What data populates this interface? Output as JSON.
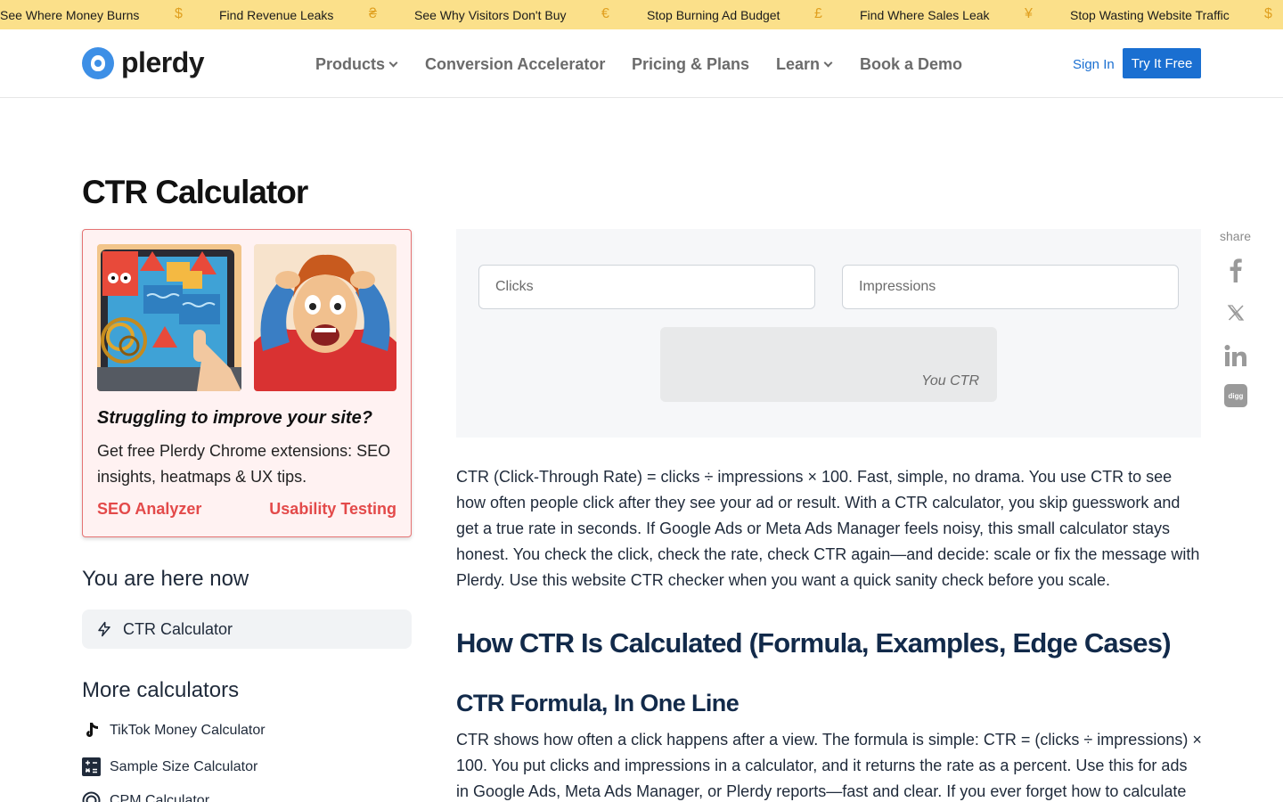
{
  "ticker": {
    "items": [
      "See Where Money Burns",
      "Find Revenue Leaks",
      "See Why Visitors Don't Buy",
      "Stop Burning Ad Budget",
      "Find Where Sales Leak",
      "Stop Wasting Website Traffic"
    ],
    "symbols": [
      "$",
      "₴",
      "€",
      "£",
      "¥",
      "$"
    ]
  },
  "header": {
    "logo_text": "plerdy",
    "nav": [
      "Products",
      "Conversion Accelerator",
      "Pricing & Plans",
      "Learn",
      "Book a Demo"
    ],
    "sign_in": "Sign In",
    "try_free": "Try It Free"
  },
  "page_title": "CTR Calculator",
  "promo": {
    "heading": "Struggling to improve your site?",
    "text": "Get free Plerdy Chrome extensions: SEO insights, heatmaps & UX tips.",
    "link1": "SEO Analyzer",
    "link2": "Usability Testing"
  },
  "sidebar": {
    "here_heading": "You are here now",
    "current": "CTR Calculator",
    "more_heading": "More calculators",
    "calculators": [
      "TikTok Money Calculator",
      "Sample Size Calculator",
      "CPM Calculator"
    ]
  },
  "calculator": {
    "clicks_placeholder": "Clicks",
    "impressions_placeholder": "Impressions",
    "result_label": "You CTR"
  },
  "share": {
    "label": "share",
    "icons": [
      "facebook-icon",
      "x-icon",
      "linkedin-icon",
      "digg-icon"
    ]
  },
  "article": {
    "intro": "CTR (Click-Through Rate) = clicks ÷ impressions × 100. Fast, simple, no drama. You use CTR to see how often people click after they see your ad or result. With a CTR calculator, you skip guesswork and get a true rate in seconds. If Google Ads or Meta Ads Manager feels noisy, this small calculator stays honest. You check the click, check the rate, check CTR again—and decide: scale or fix the message with Plerdy. Use this website CTR checker when you want a quick sanity check before you scale.",
    "h2": "How CTR Is Calculated (Formula, Examples, Edge Cases)",
    "h3": "CTR Formula, In One Line",
    "p2": "CTR shows how often a click happens after a view. The formula is simple: CTR = (clicks ÷ impressions) × 100. You put clicks and impressions in a calculator, and it returns the rate as a percent. Use this for ads in Google Ads, Meta Ads Manager, or Plerdy reports—fast and clear. If you ever forget how to calculate"
  }
}
